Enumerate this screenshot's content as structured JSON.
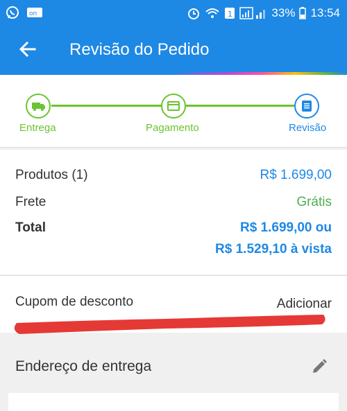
{
  "status_bar": {
    "battery": "33%",
    "time": "13:54",
    "icons": [
      "whatsapp-icon",
      "call-notification-icon",
      "alarm-icon",
      "wifi-icon",
      "sim-icon",
      "signal-icon",
      "battery-icon"
    ]
  },
  "app_bar": {
    "title": "Revisão do Pedido",
    "back_icon": "arrow-back-icon"
  },
  "steps": [
    {
      "label": "Entrega",
      "icon": "truck-icon",
      "state": "done"
    },
    {
      "label": "Pagamento",
      "icon": "card-icon",
      "state": "done"
    },
    {
      "label": "Revisão",
      "icon": "list-icon",
      "state": "current"
    }
  ],
  "summary": {
    "products_label": "Produtos (1)",
    "products_value": "R$ 1.699,00",
    "shipping_label": "Frete",
    "shipping_value": "Grátis",
    "total_label": "Total",
    "total_value_line1": "R$ 1.699,00 ou",
    "total_value_line2": "R$ 1.529,10 à vista"
  },
  "coupon": {
    "label": "Cupom de desconto",
    "action": "Adicionar"
  },
  "address": {
    "title": "Endereço de entrega",
    "edit_icon": "pencil-icon"
  },
  "colors": {
    "primary": "#1e88e5",
    "step_done": "#6ac42f",
    "free_shipping": "#4caf50",
    "annotation_red": "#e53935"
  }
}
